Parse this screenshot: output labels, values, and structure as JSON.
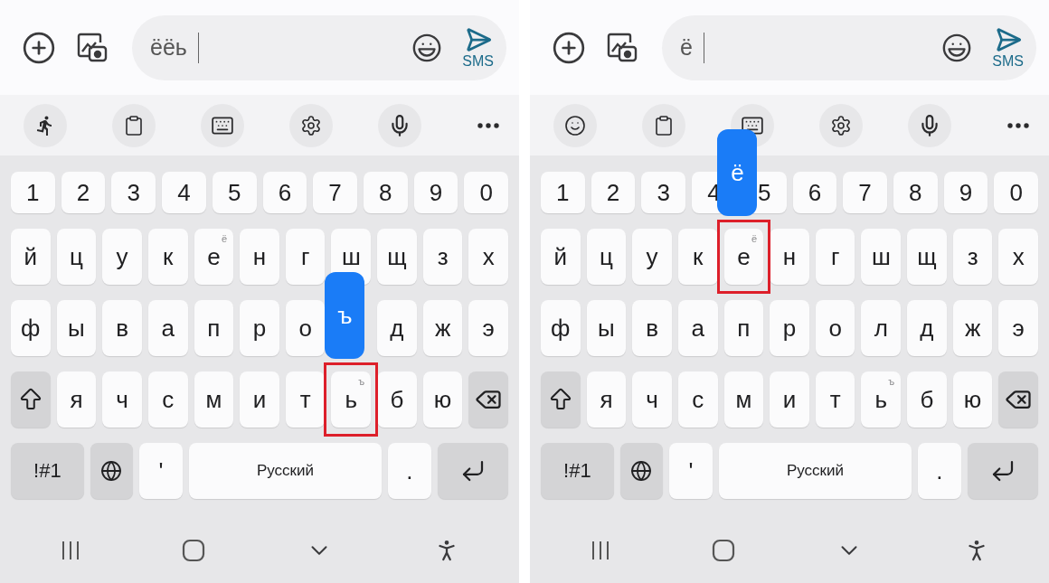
{
  "panels": [
    {
      "composer": {
        "value": "ёёь",
        "send_label": "SMS"
      },
      "toolbar": [
        {
          "kind": "runner"
        },
        {
          "kind": "clipboard"
        },
        {
          "kind": "keyboard"
        },
        {
          "kind": "settings"
        },
        {
          "kind": "mic"
        },
        {
          "kind": "more"
        }
      ],
      "keyboard": {
        "rows": [
          {
            "keys": [
              {
                "kind": "char",
                "label": "1"
              },
              {
                "kind": "char",
                "label": "2"
              },
              {
                "kind": "char",
                "label": "3"
              },
              {
                "kind": "char",
                "label": "4"
              },
              {
                "kind": "char",
                "label": "5"
              },
              {
                "kind": "char",
                "label": "6"
              },
              {
                "kind": "char",
                "label": "7"
              },
              {
                "kind": "char",
                "label": "8"
              },
              {
                "kind": "char",
                "label": "9"
              },
              {
                "kind": "char",
                "label": "0"
              }
            ]
          },
          {
            "keys": [
              {
                "kind": "char",
                "label": "й"
              },
              {
                "kind": "char",
                "label": "ц"
              },
              {
                "kind": "char",
                "label": "у"
              },
              {
                "kind": "char",
                "label": "к"
              },
              {
                "kind": "char",
                "label": "е",
                "hint": "ё"
              },
              {
                "kind": "char",
                "label": "н"
              },
              {
                "kind": "char",
                "label": "г"
              },
              {
                "kind": "char",
                "label": "ш"
              },
              {
                "kind": "char",
                "label": "щ"
              },
              {
                "kind": "char",
                "label": "з"
              },
              {
                "kind": "char",
                "label": "х"
              }
            ]
          },
          {
            "keys": [
              {
                "kind": "char",
                "label": "ф"
              },
              {
                "kind": "char",
                "label": "ы"
              },
              {
                "kind": "char",
                "label": "в"
              },
              {
                "kind": "char",
                "label": "а"
              },
              {
                "kind": "char",
                "label": "п"
              },
              {
                "kind": "char",
                "label": "р"
              },
              {
                "kind": "char",
                "label": "о"
              },
              {
                "kind": "covered"
              },
              {
                "kind": "char",
                "label": "д"
              },
              {
                "kind": "char",
                "label": "ж"
              },
              {
                "kind": "char",
                "label": "э"
              }
            ]
          },
          {
            "keys": [
              {
                "kind": "shift"
              },
              {
                "kind": "char",
                "label": "я"
              },
              {
                "kind": "char",
                "label": "ч"
              },
              {
                "kind": "char",
                "label": "с"
              },
              {
                "kind": "char",
                "label": "м"
              },
              {
                "kind": "char",
                "label": "и"
              },
              {
                "kind": "char",
                "label": "т"
              },
              {
                "kind": "char",
                "label": "ь",
                "hint": "ъ",
                "popup": "ъ",
                "highlighted": true
              },
              {
                "kind": "char",
                "label": "б"
              },
              {
                "kind": "char",
                "label": "ю"
              },
              {
                "kind": "backspace"
              }
            ]
          },
          {
            "keys": [
              {
                "kind": "symbols",
                "label": "!#1"
              },
              {
                "kind": "globe"
              },
              {
                "kind": "char",
                "label": "'"
              },
              {
                "kind": "space",
                "label": "Русский"
              },
              {
                "kind": "char",
                "label": "."
              },
              {
                "kind": "enter"
              }
            ]
          }
        ]
      }
    },
    {
      "composer": {
        "value": "ё",
        "send_label": "SMS"
      },
      "toolbar": [
        {
          "kind": "emoji"
        },
        {
          "kind": "clipboard"
        },
        {
          "kind": "keyboard"
        },
        {
          "kind": "settings"
        },
        {
          "kind": "mic"
        },
        {
          "kind": "more"
        }
      ],
      "keyboard": {
        "rows": [
          {
            "keys": [
              {
                "kind": "char",
                "label": "1"
              },
              {
                "kind": "char",
                "label": "2"
              },
              {
                "kind": "char",
                "label": "3"
              },
              {
                "kind": "char",
                "label": "4"
              },
              {
                "kind": "char",
                "label": "5"
              },
              {
                "kind": "char",
                "label": "6"
              },
              {
                "kind": "char",
                "label": "7"
              },
              {
                "kind": "char",
                "label": "8"
              },
              {
                "kind": "char",
                "label": "9"
              },
              {
                "kind": "char",
                "label": "0"
              }
            ]
          },
          {
            "keys": [
              {
                "kind": "char",
                "label": "й"
              },
              {
                "kind": "char",
                "label": "ц"
              },
              {
                "kind": "char",
                "label": "у"
              },
              {
                "kind": "char",
                "label": "к"
              },
              {
                "kind": "char",
                "label": "е",
                "hint": "ё",
                "popup": "ё",
                "highlighted": true
              },
              {
                "kind": "char",
                "label": "н"
              },
              {
                "kind": "char",
                "label": "г"
              },
              {
                "kind": "char",
                "label": "ш"
              },
              {
                "kind": "char",
                "label": "щ"
              },
              {
                "kind": "char",
                "label": "з"
              },
              {
                "kind": "char",
                "label": "х"
              }
            ]
          },
          {
            "keys": [
              {
                "kind": "char",
                "label": "ф"
              },
              {
                "kind": "char",
                "label": "ы"
              },
              {
                "kind": "char",
                "label": "в"
              },
              {
                "kind": "char",
                "label": "а"
              },
              {
                "kind": "char",
                "label": "п"
              },
              {
                "kind": "char",
                "label": "р"
              },
              {
                "kind": "char",
                "label": "о"
              },
              {
                "kind": "char",
                "label": "л"
              },
              {
                "kind": "char",
                "label": "д"
              },
              {
                "kind": "char",
                "label": "ж"
              },
              {
                "kind": "char",
                "label": "э"
              }
            ]
          },
          {
            "keys": [
              {
                "kind": "shift"
              },
              {
                "kind": "char",
                "label": "я"
              },
              {
                "kind": "char",
                "label": "ч"
              },
              {
                "kind": "char",
                "label": "с"
              },
              {
                "kind": "char",
                "label": "м"
              },
              {
                "kind": "char",
                "label": "и"
              },
              {
                "kind": "char",
                "label": "т"
              },
              {
                "kind": "char",
                "label": "ь",
                "hint": "ъ"
              },
              {
                "kind": "char",
                "label": "б"
              },
              {
                "kind": "char",
                "label": "ю"
              },
              {
                "kind": "backspace"
              }
            ]
          },
          {
            "keys": [
              {
                "kind": "symbols",
                "label": "!#1"
              },
              {
                "kind": "globe"
              },
              {
                "kind": "char",
                "label": "'"
              },
              {
                "kind": "space",
                "label": "Русский"
              },
              {
                "kind": "char",
                "label": "."
              },
              {
                "kind": "enter"
              }
            ]
          }
        ]
      }
    }
  ]
}
